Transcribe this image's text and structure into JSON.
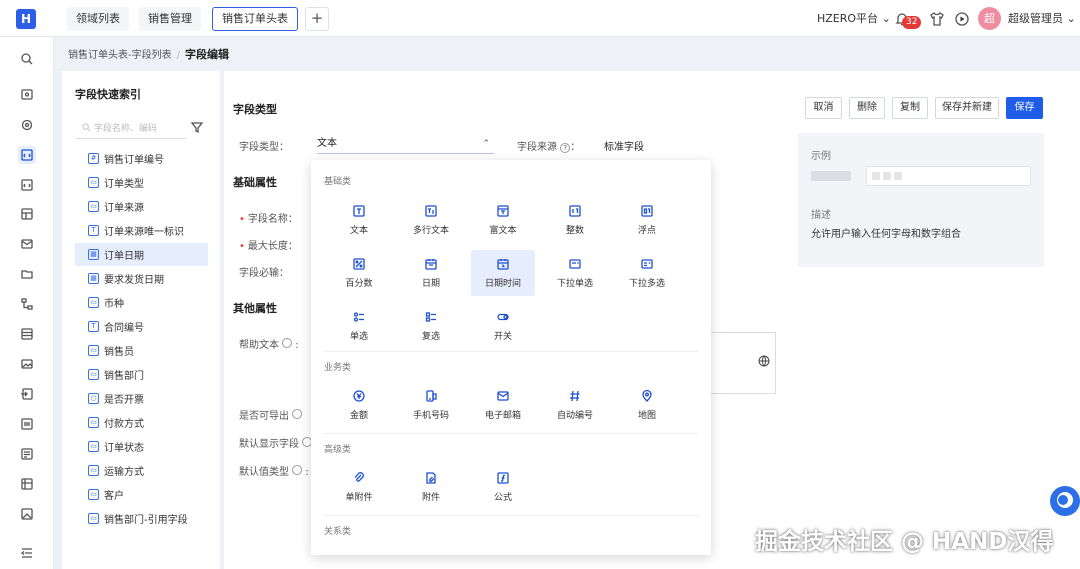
{
  "topbar": {
    "tabs": [
      "领域列表",
      "销售管理",
      "销售订单头表"
    ],
    "add_tab": "+",
    "platform": "HZERO平台",
    "platform_arrow": "⌄",
    "notification_count": "32",
    "avatar_text": "超",
    "user": "超级管理员",
    "user_arrow": "⌄"
  },
  "breadcrumb": {
    "parent": "销售订单头表-字段列表",
    "separator": "/",
    "current": "字段编辑"
  },
  "field_index": {
    "title": "字段快速索引",
    "search_placeholder": "字段名称、编码",
    "items": [
      {
        "label": "销售订单编号",
        "icon": "#"
      },
      {
        "label": "订单类型",
        "icon": "▭"
      },
      {
        "label": "订单来源",
        "icon": "▭"
      },
      {
        "label": "订单来源唯一标识",
        "icon": "T"
      },
      {
        "label": "订单日期",
        "icon": "▦"
      },
      {
        "label": "要求发货日期",
        "icon": "▦"
      },
      {
        "label": "币种",
        "icon": "▭"
      },
      {
        "label": "合同编号",
        "icon": "T"
      },
      {
        "label": "销售员",
        "icon": "▭"
      },
      {
        "label": "销售部门",
        "icon": "▭"
      },
      {
        "label": "是否开票",
        "icon": "○"
      },
      {
        "label": "付款方式",
        "icon": "▭"
      },
      {
        "label": "订单状态",
        "icon": "▭"
      },
      {
        "label": "运输方式",
        "icon": "▭"
      },
      {
        "label": "客户",
        "icon": "▭"
      },
      {
        "label": "销售部门-引用字段",
        "icon": "▭"
      }
    ],
    "active_index": 4
  },
  "form": {
    "section_type": "字段类型",
    "type_label": "字段类型：",
    "type_value": "文本",
    "type_arrow": "⌃",
    "source_label": "字段来源",
    "source_help": "?",
    "source_colon": "：",
    "source_value": "标准字段",
    "section_basic": "基础属性",
    "name_label": "字段名称：",
    "maxlen_label": "最大长度：",
    "required_label": "字段必输：",
    "section_other": "其他属性",
    "help_label": "帮助文本",
    "export_label": "是否可导出",
    "default_display_label": "默认显示字段",
    "default_value_label": "默认值类型"
  },
  "buttons": {
    "cancel": "取消",
    "delete": "删除",
    "copy": "复制",
    "save_new": "保存并新建",
    "save": "保存"
  },
  "example_panel": {
    "example_title": "示例",
    "desc_title": "描述",
    "desc_text": "允许用户输入任何字母和数字组合"
  },
  "type_dropdown": {
    "categories": [
      "基础类",
      "业务类",
      "高级类",
      "关系类"
    ],
    "basic": [
      {
        "label": "文本",
        "icon": "text-icon"
      },
      {
        "label": "多行文本",
        "icon": "multiline-text-icon"
      },
      {
        "label": "富文本",
        "icon": "rich-text-icon"
      },
      {
        "label": "整数",
        "icon": "integer-icon"
      },
      {
        "label": "浮点",
        "icon": "float-icon"
      },
      {
        "label": "百分数",
        "icon": "percent-icon"
      },
      {
        "label": "日期",
        "icon": "calendar-icon"
      },
      {
        "label": "日期时间",
        "icon": "datetime-icon"
      },
      {
        "label": "下拉单选",
        "icon": "dropdown-single-icon"
      },
      {
        "label": "下拉多选",
        "icon": "dropdown-multi-icon"
      },
      {
        "label": "单选",
        "icon": "radio-icon"
      },
      {
        "label": "复选",
        "icon": "checkbox-icon"
      },
      {
        "label": "开关",
        "icon": "switch-icon"
      }
    ],
    "business": [
      {
        "label": "金额",
        "icon": "currency-icon"
      },
      {
        "label": "手机号码",
        "icon": "phone-icon"
      },
      {
        "label": "电子邮箱",
        "icon": "mail-icon"
      },
      {
        "label": "自动编号",
        "icon": "hash-icon"
      },
      {
        "label": "地图",
        "icon": "map-pin-icon"
      }
    ],
    "advanced": [
      {
        "label": "单附件",
        "icon": "paperclip-icon"
      },
      {
        "label": "附件",
        "icon": "attachment-icon"
      },
      {
        "label": "公式",
        "icon": "formula-icon"
      }
    ],
    "selected": "日期时间"
  },
  "watermark": "掘金技术社区 @ HAND汉得",
  "colors": {
    "primary": "#1f5ce8",
    "active_bg": "#e6edfd",
    "badge": "#e53935"
  }
}
